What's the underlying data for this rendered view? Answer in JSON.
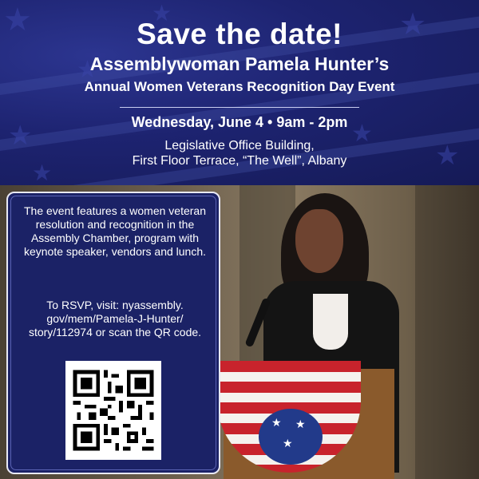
{
  "headline": "Save the date!",
  "host": "Assemblywoman Pamela Hunter’s",
  "event_name": "Annual Women Veterans Recognition Day Event",
  "datetime": "Wednesday, June 4 • 9am - 2pm",
  "location_line1": "Legislative Office Building,",
  "location_line2": "First Floor Terrace, “The Well”, Albany",
  "info": {
    "description": "The event features a women veteran resolution and recognition in the Assembly Chamber, program with keynote speaker, vendors and lunch.",
    "rsvp": "To RSVP, visit: nyassembly. gov/mem/Pamela-J-Hunter/ story/112974 or scan the QR code."
  },
  "colors": {
    "navy": "#1d2370",
    "card_navy": "#1b2266",
    "text": "#ffffff"
  },
  "icons": [
    "star-icon",
    "qr-code-icon",
    "microphone-icon",
    "flag-bunting-icon"
  ]
}
